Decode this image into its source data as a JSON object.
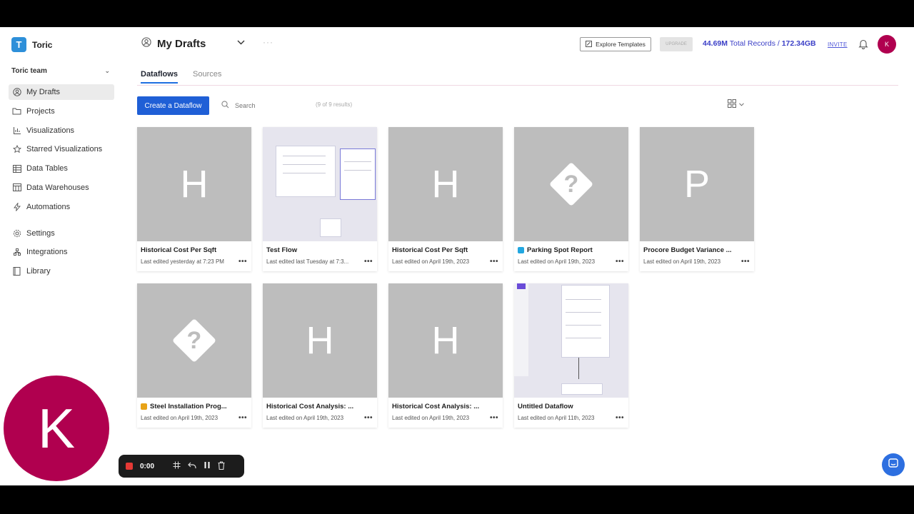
{
  "app": {
    "name": "Toric",
    "logo_letter": "T"
  },
  "sidebar": {
    "team_label": "Toric team",
    "items": [
      {
        "label": "My Drafts",
        "icon": "user-circle-icon",
        "active": true
      },
      {
        "label": "Projects",
        "icon": "folder-icon"
      },
      {
        "label": "Visualizations",
        "icon": "chart-icon"
      },
      {
        "label": "Starred Visualizations",
        "icon": "star-icon"
      },
      {
        "label": "Data Tables",
        "icon": "table-icon"
      },
      {
        "label": "Data Warehouses",
        "icon": "warehouse-icon"
      },
      {
        "label": "Automations",
        "icon": "lightning-icon"
      },
      {
        "label": "Settings",
        "icon": "gear-icon"
      },
      {
        "label": "Integrations",
        "icon": "integrations-icon"
      },
      {
        "label": "Library",
        "icon": "book-icon"
      }
    ]
  },
  "header": {
    "title": "My Drafts",
    "explore_label": "Explore Templates",
    "upgrade_label": "UPGRADE",
    "records_count": "44.69M",
    "records_label": "Total Records /",
    "storage": "172.34GB",
    "invite_label": "INVITE",
    "avatar_initial": "K"
  },
  "tabs": {
    "dataflows": "Dataflows",
    "sources": "Sources"
  },
  "toolbar": {
    "create_label": "Create a Dataflow",
    "search_placeholder": "Search",
    "results_text": "(9 of 9 results)"
  },
  "cards": [
    {
      "name": "Historical Cost Per Sqft",
      "meta": "Last edited yesterday at 7:23 PM",
      "thumb": "H"
    },
    {
      "name": "Test Flow",
      "meta": "Last edited last Tuesday at 7:3...",
      "thumb": "preview"
    },
    {
      "name": "Historical Cost Per Sqft",
      "meta": "Last edited on April 19th, 2023",
      "thumb": "H"
    },
    {
      "name": "Parking Spot Report",
      "meta": "Last edited on April 19th, 2023",
      "thumb": "?",
      "tag_color": "#22a7e0"
    },
    {
      "name": "Procore Budget Variance ...",
      "meta": "Last edited on April 19th, 2023",
      "thumb": "P"
    },
    {
      "name": "Steel Installation Prog...",
      "meta": "Last edited on April 19th, 2023",
      "thumb": "?",
      "tag_color": "#e8a317"
    },
    {
      "name": "Historical Cost Analysis: ...",
      "meta": "Last edited on April 19th, 2023",
      "thumb": "H"
    },
    {
      "name": "Historical Cost Analysis: ...",
      "meta": "Last edited on April 19th, 2023",
      "thumb": "H"
    },
    {
      "name": "Untitled Dataflow",
      "meta": "Last edited on April 11th, 2023",
      "thumb": "preview2"
    }
  ],
  "overlay": {
    "avatar_initial": "K",
    "recorder_time": "0:00"
  },
  "colors": {
    "primary": "#1f5fd6",
    "avatar": "#b0004f",
    "records": "#3b3fc7",
    "thumb_gray": "#bdbdbd"
  }
}
